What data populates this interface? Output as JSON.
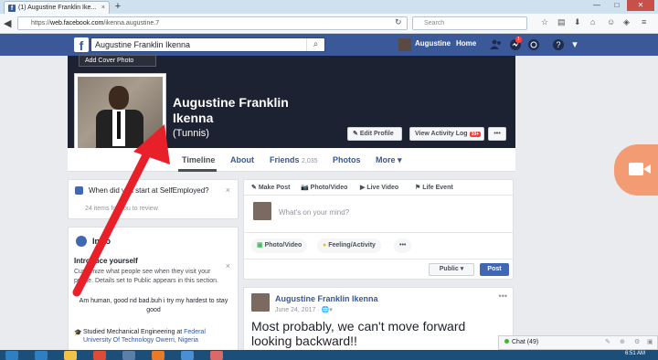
{
  "browser": {
    "tab_title": "(1) Augustine Franklin Ike...",
    "tab_close": "×",
    "new_tab": "+",
    "url_scheme": "https://",
    "url_domain": "web.facebook.com",
    "url_path": "/ikenna.augustine.7",
    "search_placeholder": "Search",
    "minimize": "—",
    "maximize": "□",
    "close": "✕"
  },
  "fb": {
    "logo": "f",
    "search_value": "Augustine Franklin Ikenna",
    "search_icon": "⌕",
    "user_name": "Augustine",
    "home_label": "Home",
    "notif_count": "1",
    "friends_icon": "👥",
    "messages_icon": "✉",
    "globe_icon": "◉",
    "help_icon": "?",
    "menu_icon": "▾"
  },
  "cover": {
    "add_cover": "Add Cover Photo",
    "name": "Augustine Franklin Ikenna",
    "nickname": "(Tunnis)",
    "edit_profile": "Edit Profile",
    "activity_log": "View Activity Log",
    "activity_badge": "10+",
    "more": "•••"
  },
  "tabs": {
    "timeline": "Timeline",
    "about": "About",
    "friends": "Friends",
    "friends_count": "2,035",
    "photos": "Photos",
    "more": "More ▾"
  },
  "left": {
    "question": "When did you start at SelfEmployed?",
    "question_sub": "24 items for you to review",
    "close": "×",
    "intro_title": "Intro",
    "intro_head": "Introduce yourself",
    "intro_desc": "Customize what people see when they visit your profile. Details set to Public appears in this section.",
    "bio": "Am human, good nd bad.buh i try my hardest to stay good",
    "edu_prefix": "Studied Mechanical Engineering at ",
    "edu_school": "Federal University Of Technology Owerri, Nigeria"
  },
  "composer": {
    "make_post": "Make Post",
    "photo_video": "Photo/Video",
    "live_video": "Live Video",
    "life_event": "Life Event",
    "placeholder": "What's on your mind?",
    "pill_photo": "Photo/Video",
    "pill_feeling": "Feeling/Activity",
    "pill_more": "•••",
    "privacy": "Public ▾",
    "post": "Post"
  },
  "post": {
    "author": "Augustine Franklin Ikenna",
    "date": "June 24, 2017 · 🌐▾",
    "more": "•••",
    "text": "Most probably, we can't move forward looking backward!!"
  },
  "chat": {
    "label": "Chat (49)"
  },
  "taskbar": {
    "time": "6:51 AM"
  },
  "colors": {
    "fb_blue": "#3b5998",
    "cover_dark": "#1d2232",
    "arrow_red": "#e8202a",
    "video_orange": "#f39c73"
  }
}
